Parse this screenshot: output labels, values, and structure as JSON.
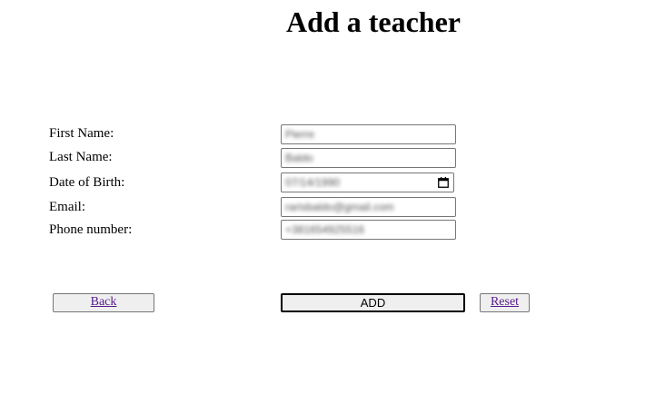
{
  "page_title": "Add a teacher",
  "form": {
    "first_name": {
      "label": "First Name:",
      "value": "Pierre"
    },
    "last_name": {
      "label": "Last Name:",
      "value": "Baldo"
    },
    "date_of_birth": {
      "label": "Date of Birth:",
      "value": "07/14/1990"
    },
    "email": {
      "label": "Email:",
      "value": "rarisbaldo@gmail.com"
    },
    "phone": {
      "label": "Phone number:",
      "value": "+381654925516"
    }
  },
  "buttons": {
    "back_label": "Back",
    "add_label": "ADD",
    "reset_label": "Reset"
  },
  "icons": {
    "date_picker": "calendar-icon"
  },
  "colors": {
    "link": "#551a8b",
    "button_bg": "#efefef",
    "field_border": "#767676"
  }
}
